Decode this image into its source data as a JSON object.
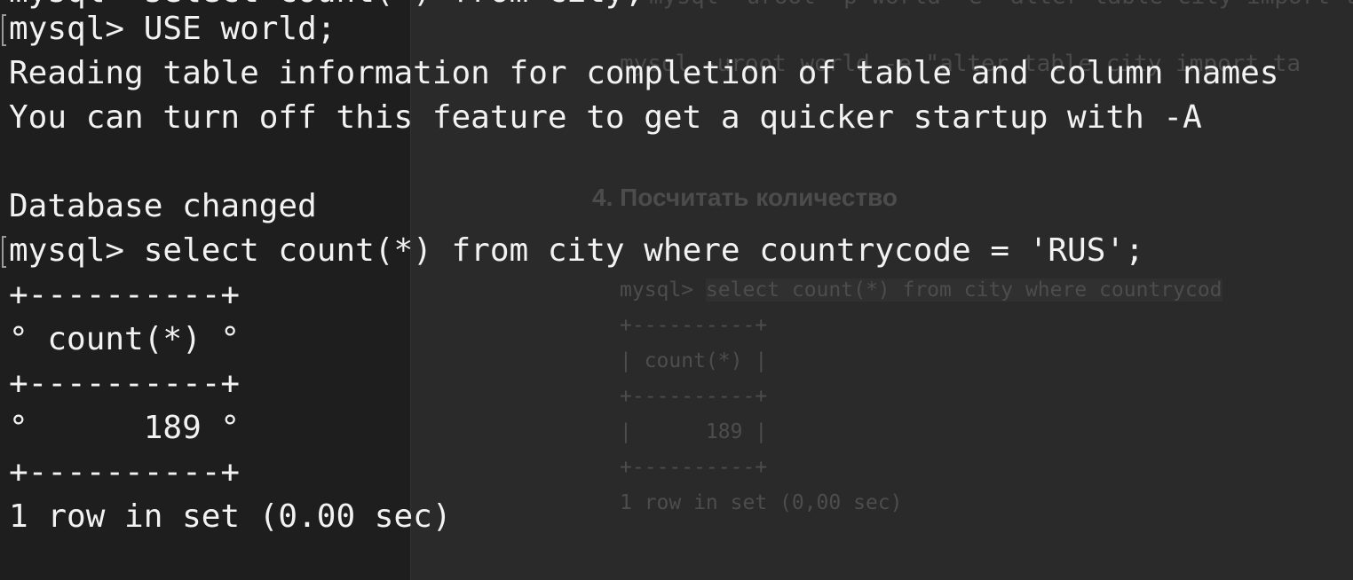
{
  "background_document": {
    "top_cutoff_line": "mysql -uroot -p world -e \"alter table city import tablespace;\"",
    "command_line": "mysql -uroot world -e \"alter table city import ta",
    "section_heading": "4. Посчитать количество",
    "code_prompt": "mysql> ",
    "code_query": "select count(*) from city where countrycod",
    "result_border_top": "+----------+",
    "result_header": "| count(*) |",
    "result_border_mid": "+----------+",
    "result_value": "|      189 |",
    "result_border_bottom": "+----------+",
    "result_footer": "1 row in set (0,00 sec)"
  },
  "terminal": {
    "top_cutoff_line": "mysql> select count(*) from city;",
    "lines": [
      "mysql> USE world;",
      "Reading table information for completion of table and column names",
      "You can turn off this feature to get a quicker startup with -A",
      "",
      "Database changed",
      "mysql> select count(*) from city where countrycode = 'RUS';",
      "+----------+",
      "° count(*) °",
      "+----------+",
      "°      189 °",
      "+----------+",
      "1 row in set (0.00 sec)"
    ]
  },
  "colors": {
    "terminal_background": "#1e1e1e",
    "terminal_text": "#f2f2f2",
    "background_document_text": "#4d4d4d"
  }
}
